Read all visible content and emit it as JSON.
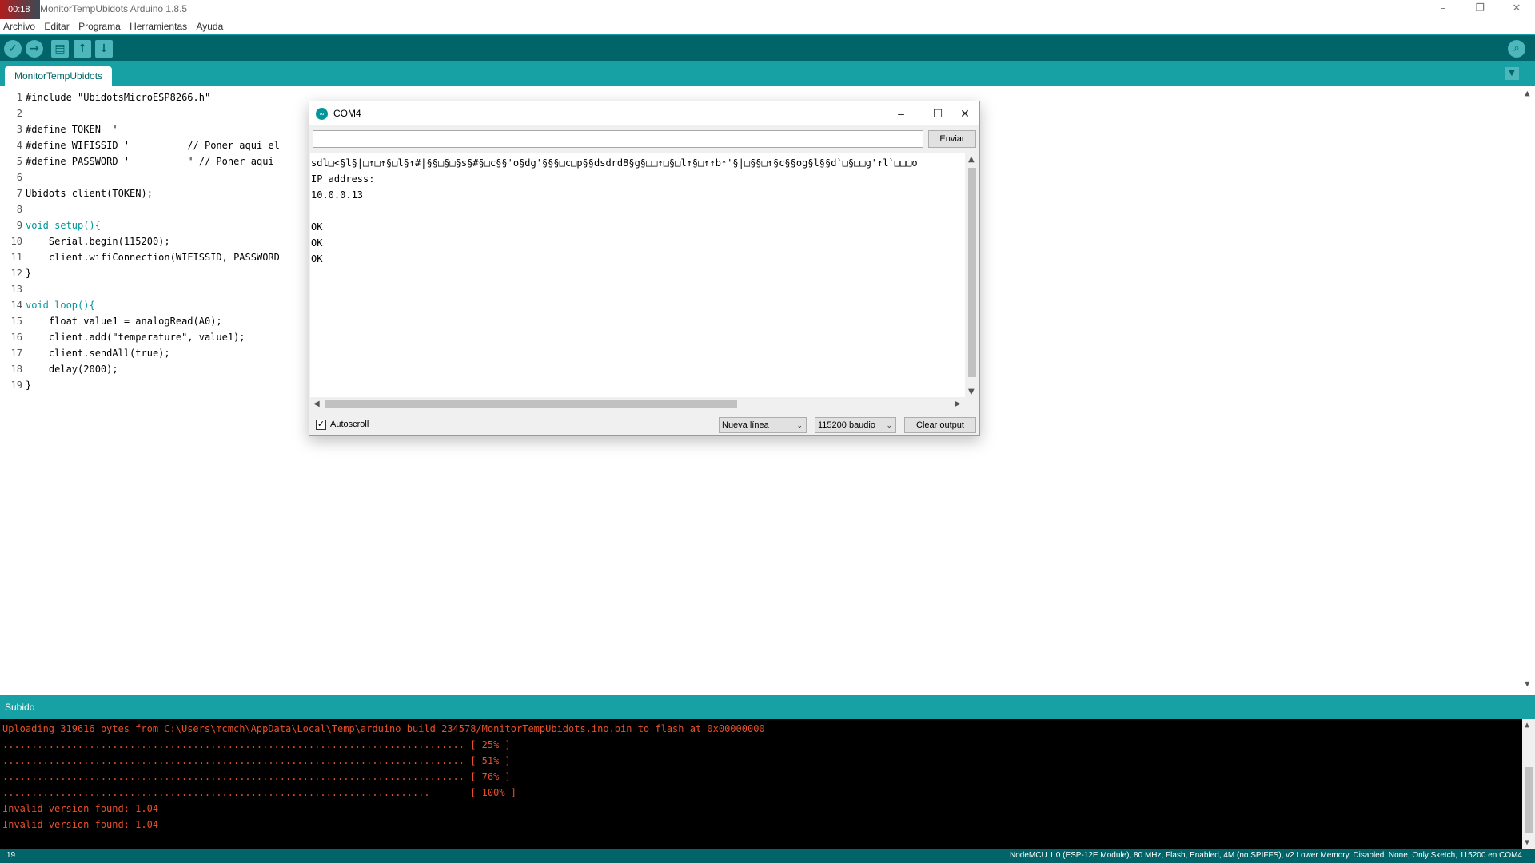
{
  "window": {
    "timer": "00:18",
    "title": "MonitorTempUbidots Arduino 1.8.5",
    "minimize": "–",
    "restore": "❐",
    "close": "✕"
  },
  "menu": [
    "Archivo",
    "Editar",
    "Programa",
    "Herramientas",
    "Ayuda"
  ],
  "toolbar": {
    "verify_icon": "check-icon",
    "upload_icon": "arrow-right-icon",
    "new_icon": "file-icon",
    "open_icon": "arrow-up-icon",
    "save_icon": "arrow-down-icon",
    "serial_icon": "magnifier-icon"
  },
  "tab": {
    "label": "MonitorTempUbidots"
  },
  "editor": {
    "line_numbers": [
      "1",
      "2",
      "3",
      "4",
      "5",
      "6",
      "7",
      "8",
      "9",
      "10",
      "11",
      "12",
      "13",
      "14",
      "15",
      "16",
      "17",
      "18",
      "19"
    ],
    "lines": [
      "#include \"UbidotsMicroESP8266.h\"",
      "",
      "#define TOKEN  '",
      "#define WIFISSID '          // Poner aqui el",
      "#define PASSWORD '          \" // Poner aqui",
      "",
      "Ubidots client(TOKEN);",
      "",
      "void setup(){",
      "    Serial.begin(115200);",
      "    client.wifiConnection(WIFISSID, PASSWORD",
      "}",
      "",
      "void loop(){",
      "    float value1 = analogRead(A0);",
      "    client.add(\"temperature\", value1);",
      "    client.sendAll(true);",
      "    delay(2000);",
      "}"
    ]
  },
  "serial": {
    "title": "COM4",
    "input_value": "",
    "send_label": "Enviar",
    "output": [
      "sdl□<§l§|□↑□↑§□l§↑#|§§□§□§s§#§□c§§'o§dg'§§§□c□p§§dsdrd8§g§□□↑□§□l↑§□↑↑b↑'§|□§§□↑§c§§og§l§§d`□§□□g'↑l`□□□o",
      "IP address:",
      "10.0.0.13",
      "",
      "OK",
      "OK",
      "OK"
    ],
    "autoscroll_label": "Autoscroll",
    "autoscroll_checked": "✓",
    "line_ending": "Nueva línea",
    "baud": "115200 baudio",
    "clear_label": "Clear output"
  },
  "status": {
    "label": "Subido"
  },
  "console": {
    "lines": [
      "Uploading 319616 bytes from C:\\Users\\mcmch\\AppData\\Local\\Temp\\arduino_build_234578/MonitorTempUbidots.ino.bin to flash at 0x00000000",
      "................................................................................ [ 25% ]",
      "................................................................................ [ 51% ]",
      "................................................................................ [ 76% ]",
      "..........................................................................       [ 100% ]",
      "Invalid version found: 1.04",
      "Invalid version found: 1.04"
    ]
  },
  "bottom": {
    "line": "19",
    "board": "NodeMCU 1.0 (ESP-12E Module), 80 MHz, Flash, Enabled, 4M (no SPIFFS), v2 Lower Memory, Disabled, None, Only Sketch, 115200 en COM4"
  },
  "colors": {
    "toolbar": "#006468",
    "tabbar": "#17a1a5",
    "keyword": "#00979c",
    "function": "#d35400",
    "console_text": "#e8502a"
  }
}
